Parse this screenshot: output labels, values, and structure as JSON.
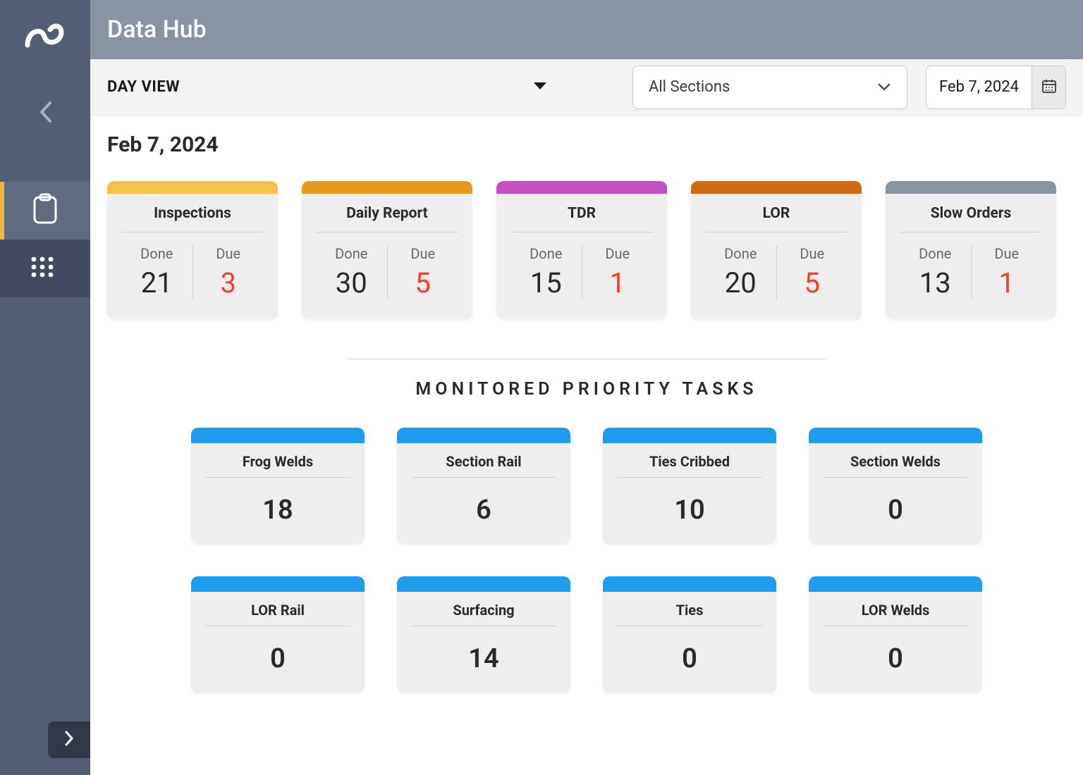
{
  "header": {
    "title": "Data Hub"
  },
  "subheader": {
    "view_label": "DAY VIEW",
    "section_select": "All Sections",
    "date_display": "Feb 7, 2024"
  },
  "content": {
    "date_heading": "Feb 7, 2024",
    "summary_cards": [
      {
        "title": "Inspections",
        "done_label": "Done",
        "done": "21",
        "due_label": "Due",
        "due": "3",
        "color": "#f3c24a"
      },
      {
        "title": "Daily Report",
        "done_label": "Done",
        "done": "30",
        "due_label": "Due",
        "due": "5",
        "color": "#e79a1a"
      },
      {
        "title": "TDR",
        "done_label": "Done",
        "done": "15",
        "due_label": "Due",
        "due": "1",
        "color": "#c84fc1"
      },
      {
        "title": "LOR",
        "done_label": "Done",
        "done": "20",
        "due_label": "Due",
        "due": "5",
        "color": "#cf6a12"
      },
      {
        "title": "Slow Orders",
        "done_label": "Done",
        "done": "13",
        "due_label": "Due",
        "due": "1",
        "color": "#8994a3"
      }
    ],
    "tasks_section_title": "MONITORED PRIORITY TASKS",
    "task_cards": [
      {
        "title": "Frog Welds",
        "value": "18"
      },
      {
        "title": "Section Rail",
        "value": "6"
      },
      {
        "title": "Ties Cribbed",
        "value": "10"
      },
      {
        "title": "Section Welds",
        "value": "0"
      },
      {
        "title": "LOR Rail",
        "value": "0"
      },
      {
        "title": "Surfacing",
        "value": "14"
      },
      {
        "title": "Ties",
        "value": "0"
      },
      {
        "title": "LOR Welds",
        "value": "0"
      }
    ]
  }
}
